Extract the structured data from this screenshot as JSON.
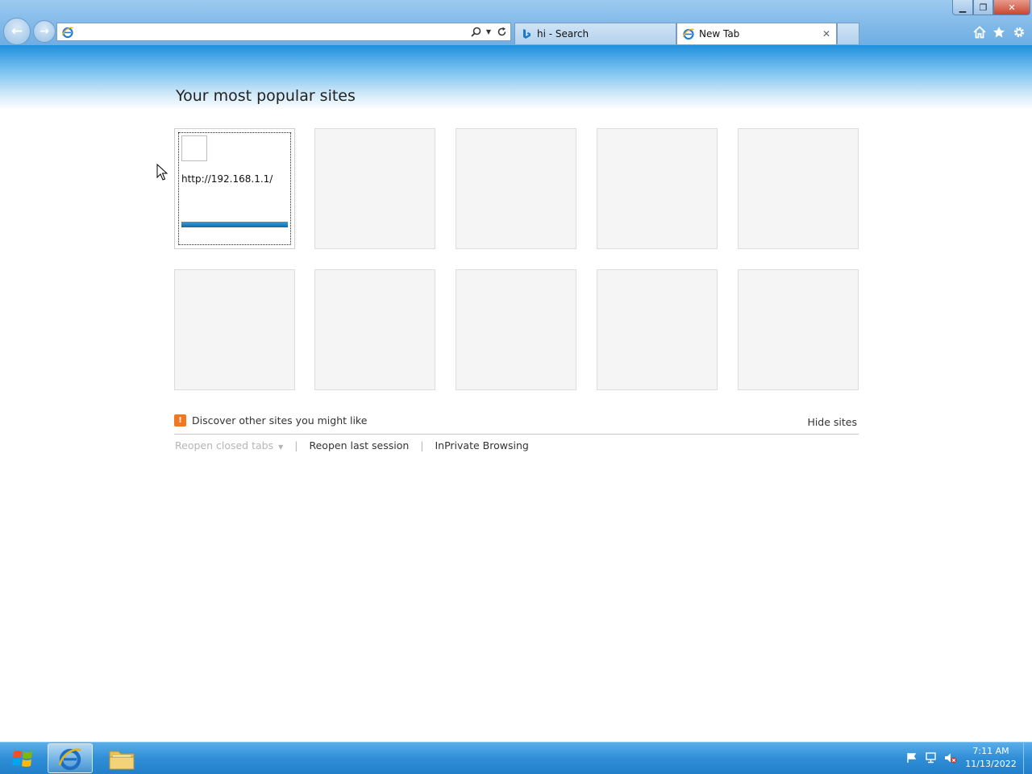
{
  "window": {
    "minimize_icon": "minimize-icon",
    "maximize_icon": "restore-icon",
    "close_icon": "close-icon"
  },
  "toolbar": {
    "back_icon": "back-arrow-icon",
    "forward_icon": "forward-arrow-icon",
    "address": {
      "value": "",
      "placeholder": "",
      "site_icon": "ie-icon",
      "search_icon": "search-icon",
      "dropdown_icon": "chevron-down-icon",
      "refresh_icon": "refresh-icon"
    },
    "home_icon": "home-icon",
    "favorites_icon": "star-icon",
    "tools_icon": "gear-icon"
  },
  "tabs": [
    {
      "label": "hi - Search",
      "icon": "bing-icon",
      "active": false
    },
    {
      "label": "New Tab",
      "icon": "ie-icon",
      "active": true,
      "close_label": "✕"
    }
  ],
  "new_tab_page": {
    "title": "Your most popular sites",
    "tiles": [
      {
        "url": "http://192.168.1.1/",
        "activity": 1.0
      },
      {
        "url": ""
      },
      {
        "url": ""
      },
      {
        "url": ""
      },
      {
        "url": ""
      },
      {
        "url": ""
      },
      {
        "url": ""
      },
      {
        "url": ""
      },
      {
        "url": ""
      },
      {
        "url": ""
      }
    ],
    "discover_label": "Discover other sites you might like",
    "hide_sites_label": "Hide sites",
    "reopen_closed_tabs_label": "Reopen closed tabs",
    "reopen_last_session_label": "Reopen last session",
    "inprivate_label": "InPrivate Browsing",
    "separator": "|"
  },
  "taskbar": {
    "start_icon": "windows-logo-icon",
    "items": [
      {
        "name": "Internet Explorer",
        "icon": "ie-icon",
        "active": true
      },
      {
        "name": "Windows Explorer",
        "icon": "folder-icon",
        "active": false
      }
    ],
    "tray": {
      "icons": [
        "action-center-flag-icon",
        "network-icon",
        "volume-muted-icon"
      ],
      "time": "7:11 AM",
      "date": "11/13/2022"
    }
  },
  "colors": {
    "accent": "#1f8fdc",
    "taskbar": "#2f8ed6",
    "tile_bar": "#0b6aa8",
    "discover_icon": "#f07822"
  }
}
